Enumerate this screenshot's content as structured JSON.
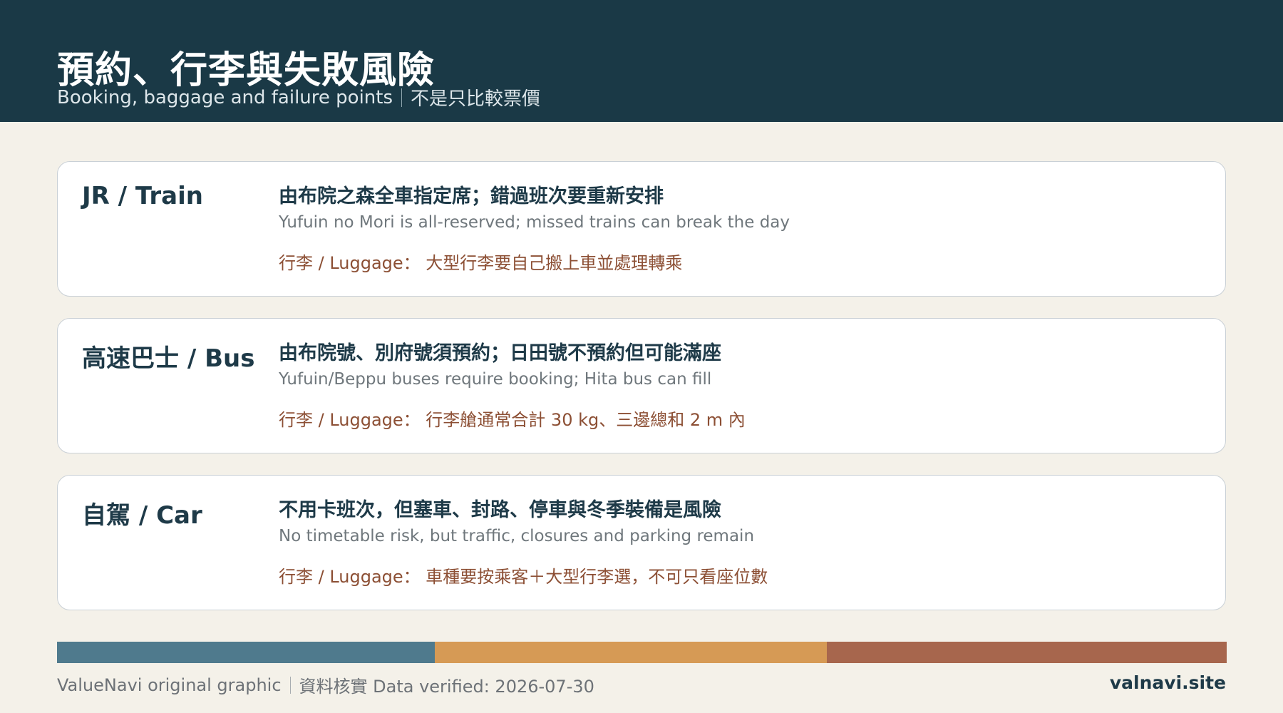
{
  "header": {
    "title": "預約、行李與失敗風險",
    "subtitle_en": "Booking, baggage and failure points",
    "subtitle_zh": "不是只比較票價"
  },
  "cards": [
    {
      "mode": "JR / Train",
      "headline": "由布院之森全車指定席；錯過班次要重新安排",
      "description": "Yufuin no Mori is all-reserved; missed trains can break the day",
      "luggage": "行李 / Luggage： 大型行李要自己搬上車並處理轉乘"
    },
    {
      "mode": "高速巴士 / Bus",
      "headline": "由布院號、別府號須預約；日田號不預約但可能滿座",
      "description": "Yufuin/Beppu buses require booking; Hita bus can fill",
      "luggage": "行李 / Luggage： 行李艙通常合計 30 kg、三邊總和 2 m 內"
    },
    {
      "mode": "自駕 / Car",
      "headline": "不用卡班次，但塞車、封路、停車與冬季裝備是風險",
      "description": "No timetable risk, but traffic, closures and parking remain",
      "luggage": "行李 / Luggage： 車種要按乘客＋大型行李選，不可只看座位數"
    }
  ],
  "color_bar": {
    "colors": [
      "#4f7a8d",
      "#d69a55",
      "#a7664d"
    ]
  },
  "footer": {
    "credit": "ValueNavi original graphic",
    "verified": "資料核實 Data verified: 2026-07-30",
    "site": "valnavi.site"
  }
}
